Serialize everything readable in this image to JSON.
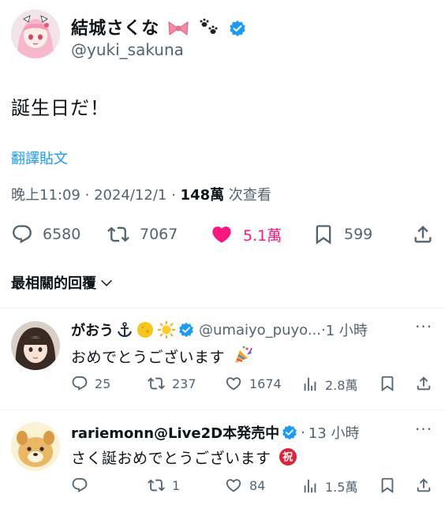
{
  "author": {
    "name": "結城さくな",
    "handle": "@yuki_sakuna",
    "emoji": [
      "ribbon-emoji",
      "paw-prints-emoji"
    ],
    "verified": true
  },
  "tweet": {
    "text": "誕生日だ！",
    "translate_label": "翻譯貼文",
    "time": "晚上11:09",
    "date": "2024/12/1",
    "views_count": "148萬",
    "views_label": "次查看"
  },
  "actions": {
    "replies": "6580",
    "reposts": "7067",
    "likes": "5.1萬",
    "bookmarks": "599"
  },
  "sort": {
    "label": "最相關的回覆"
  },
  "replies": [
    {
      "name": "がおう",
      "emoji": [
        "anchor-emoji",
        "moon-emoji",
        "sun-emoji"
      ],
      "verified": true,
      "handle": "@umaiyo_puyo...",
      "time": "1 小時",
      "text": "おめでとうございます",
      "text_emoji": "party-popper-emoji",
      "stats": {
        "replies": "25",
        "reposts": "237",
        "likes": "1674",
        "views": "2.8萬"
      }
    },
    {
      "name": "rariemonn@Live2D本発売中",
      "verified": true,
      "time": "13 小時",
      "text": "さく誕おめでとうございます",
      "text_emoji": "congratulation-emoji",
      "stats": {
        "replies": "",
        "reposts": "1",
        "likes": "84",
        "views": "1.5萬"
      }
    }
  ],
  "colors": {
    "accent": "#1d9bf0",
    "like": "#f91880",
    "text": "#0f1419",
    "secondary": "#536471",
    "divider": "#eff3f4"
  }
}
